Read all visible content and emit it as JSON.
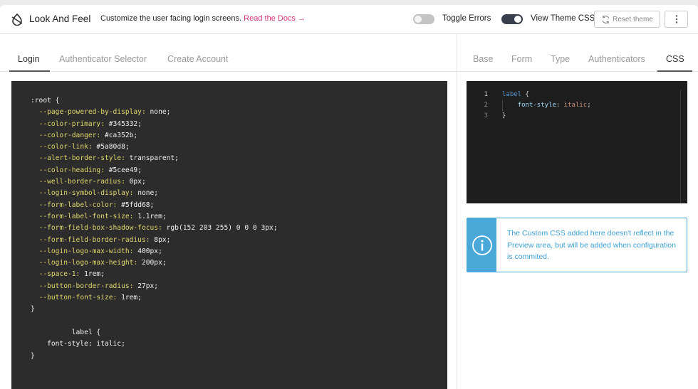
{
  "header": {
    "title": "Look And Feel",
    "description": "Customize the user facing login screens.",
    "docs_link": "Read the Docs →",
    "toggle_errors_label": "Toggle Errors",
    "toggle_errors_on": false,
    "view_theme_label": "View Theme CSS",
    "view_theme_on": true,
    "reset_label": "Reset theme"
  },
  "left_tabs": [
    {
      "label": "Login",
      "active": true
    },
    {
      "label": "Authenticator Selector",
      "active": false
    },
    {
      "label": "Create Account",
      "active": false
    }
  ],
  "theme_css": {
    "lines": [
      [
        ":root {",
        null
      ],
      [
        "  ",
        "--page-powered-by-display:",
        " none;"
      ],
      [
        "  ",
        "--color-primary:",
        " #345332;"
      ],
      [
        "  ",
        "--color-danger:",
        " #ca352b;"
      ],
      [
        "  ",
        "--color-link:",
        " #5a80d8;"
      ],
      [
        "  ",
        "--alert-border-style:",
        " transparent;"
      ],
      [
        "  ",
        "--color-heading:",
        " #5cee49;"
      ],
      [
        "  ",
        "--well-border-radius:",
        " 0px;"
      ],
      [
        "  ",
        "--login-symbol-display:",
        " none;"
      ],
      [
        "  ",
        "--form-label-color:",
        " #5fdd68;"
      ],
      [
        "  ",
        "--form-label-font-size:",
        " 1.1rem;"
      ],
      [
        "  ",
        "--form-field-box-shadow-focus:",
        " rgb(152 203 255) 0 0 0 3px;"
      ],
      [
        "  ",
        "--form-field-border-radius:",
        " 8px;"
      ],
      [
        "  ",
        "--login-logo-max-width:",
        " 400px;"
      ],
      [
        "  ",
        "--login-logo-max-height:",
        " 200px;"
      ],
      [
        "  ",
        "--space-1:",
        " 1rem;"
      ],
      [
        "  ",
        "--button-border-radius:",
        " 27px;"
      ],
      [
        "  ",
        "--button-font-size:",
        " 1rem;"
      ],
      [
        "}",
        null
      ],
      [
        "",
        null
      ],
      [
        "          label {",
        null
      ],
      [
        "    font-style: italic;",
        null
      ],
      [
        "}",
        null
      ]
    ]
  },
  "right_tabs": [
    {
      "label": "Base",
      "active": false
    },
    {
      "label": "Form",
      "active": false
    },
    {
      "label": "Type",
      "active": false
    },
    {
      "label": "Authenticators",
      "active": false
    },
    {
      "label": "CSS",
      "active": true
    }
  ],
  "editor": {
    "line_numbers": [
      "1",
      "2",
      "3"
    ],
    "selector": "label",
    "open_brace": " {",
    "property": "font-style",
    "colon": ": ",
    "value": "italic",
    "semicolon": ";",
    "close_brace": "}"
  },
  "info": {
    "text": "The Custom CSS added here doesn't reflect in the Preview area, but will be added when configuration is commited."
  },
  "colors": {
    "accent_link": "#d5357f",
    "info_blue": "#4aa8d8",
    "code_bg": "#2c2c2c",
    "editor_bg": "#1e1e1e",
    "css_property": "#e0d66b"
  },
  "icons": {
    "logo": "theme-droplet-icon",
    "reset": "refresh-icon",
    "menu": "kebab-menu-icon",
    "info": "info-circle-icon"
  }
}
